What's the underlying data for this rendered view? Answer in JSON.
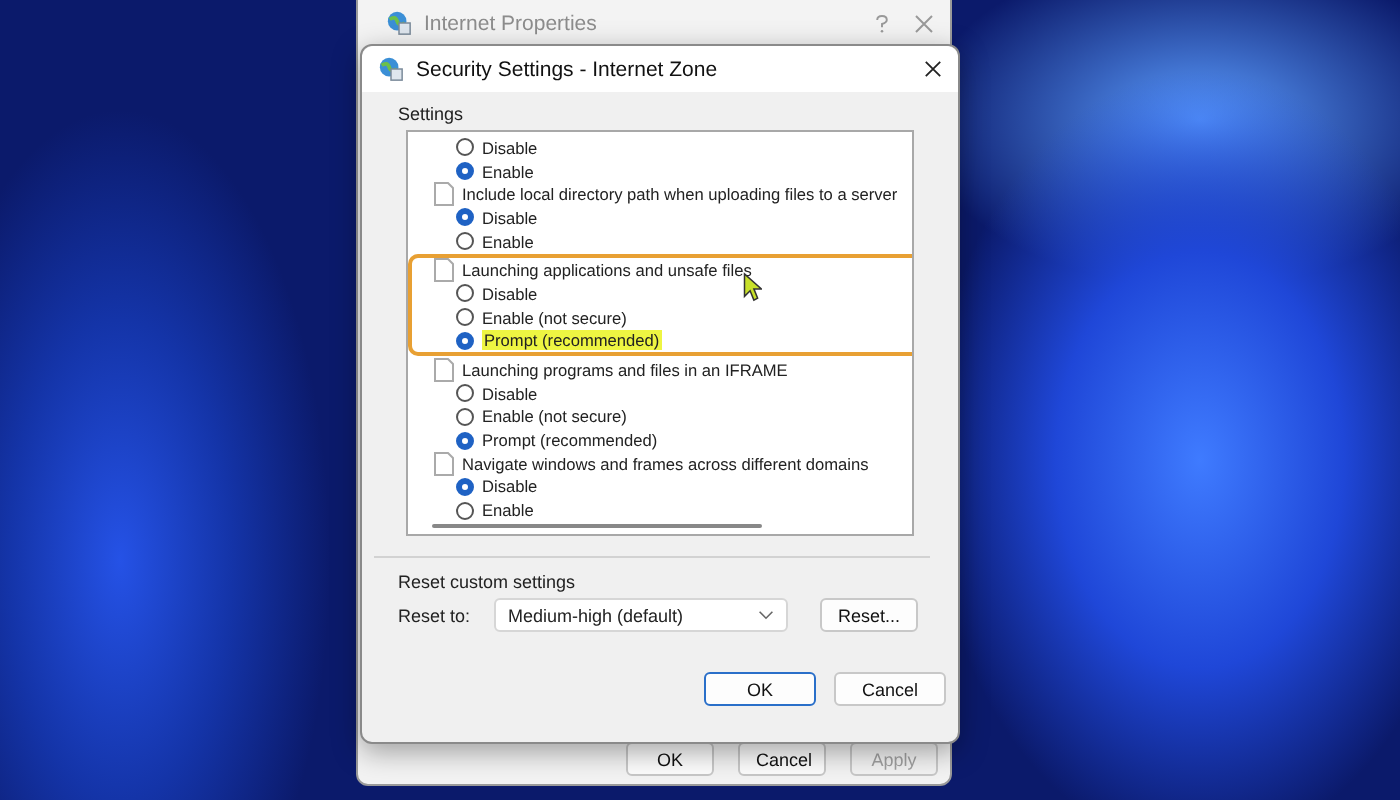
{
  "back_window": {
    "title": "Internet Properties",
    "buttons": [
      {
        "label": "OK",
        "disabled": false
      },
      {
        "label": "Cancel",
        "disabled": false
      },
      {
        "label": "Apply",
        "disabled": true
      }
    ]
  },
  "dialog": {
    "title": "Security Settings - Internet Zone",
    "settings_label": "Settings",
    "settings": [
      {
        "highlighted": false,
        "options": [
          {
            "label": "Disable",
            "selected": false,
            "highlighted": false
          },
          {
            "label": "Enable",
            "selected": true,
            "highlighted": false
          }
        ]
      },
      {
        "heading": "Include local directory path when uploading files to a server",
        "highlighted": false,
        "options": [
          {
            "label": "Disable",
            "selected": true,
            "highlighted": false
          },
          {
            "label": "Enable",
            "selected": false,
            "highlighted": false
          }
        ]
      },
      {
        "heading": "Launching applications and unsafe files",
        "highlighted": true,
        "options": [
          {
            "label": "Disable",
            "selected": false,
            "highlighted": false
          },
          {
            "label": "Enable (not secure)",
            "selected": false,
            "highlighted": false
          },
          {
            "label": "Prompt (recommended)",
            "selected": true,
            "highlighted": true
          }
        ]
      },
      {
        "heading": "Launching programs and files in an IFRAME",
        "highlighted": false,
        "options": [
          {
            "label": "Disable",
            "selected": false,
            "highlighted": false
          },
          {
            "label": "Enable (not secure)",
            "selected": false,
            "highlighted": false
          },
          {
            "label": "Prompt (recommended)",
            "selected": true,
            "highlighted": false
          }
        ]
      },
      {
        "heading": "Navigate windows and frames across different domains",
        "highlighted": false,
        "options": [
          {
            "label": "Disable",
            "selected": true,
            "highlighted": false
          },
          {
            "label": "Enable",
            "selected": false,
            "highlighted": false
          }
        ]
      }
    ],
    "reset_group_label": "Reset custom settings",
    "reset_to_label": "Reset to:",
    "reset_to_value": "Medium-high (default)",
    "reset_button": "Reset...",
    "buttons": [
      {
        "label": "OK",
        "default": true
      },
      {
        "label": "Cancel",
        "default": false
      }
    ]
  }
}
